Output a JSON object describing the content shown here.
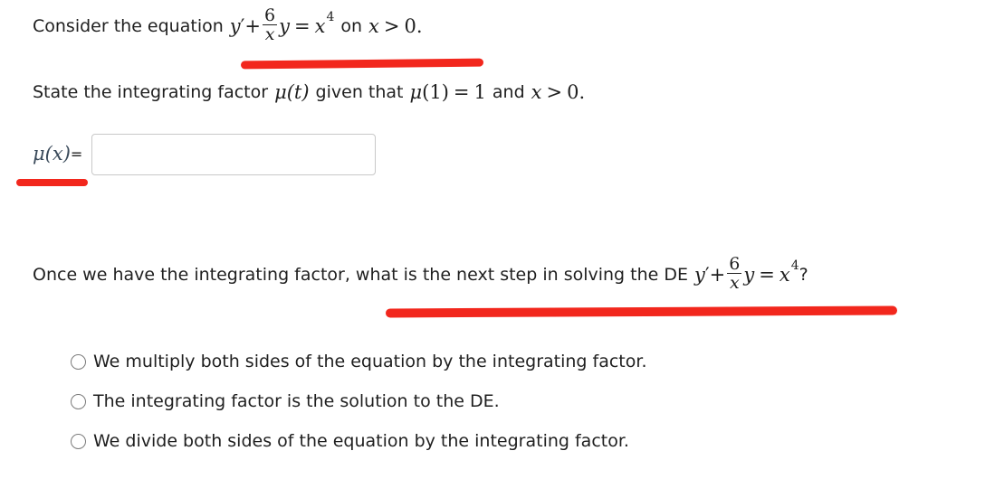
{
  "q1": {
    "prefix": "Consider the equation",
    "y": "y",
    "prime": "′",
    "plus": "+",
    "num": "6",
    "den": "x",
    "y2": "y",
    "eq": "=",
    "x": "x",
    "exp": "4",
    "on": "on",
    "cond_x": "x",
    "cond_gt": ">",
    "cond_zero": "0",
    "cond_dot": "."
  },
  "q2": {
    "prefix": "State the integrating factor",
    "mu": "μ",
    "t": "(t)",
    "given": "given that",
    "mu2": "μ",
    "one_arg": "(1)",
    "eq": "=",
    "one": "1",
    "and": "and",
    "x": "x",
    "gt": ">",
    "zero": "0",
    "dot": "."
  },
  "answer": {
    "mu": "μ",
    "arg": "(x)",
    "eq": "=",
    "value": ""
  },
  "q3": {
    "prefix": "Once we have the integrating factor, what is the next step in solving the DE",
    "y": "y",
    "prime": "′",
    "plus": "+",
    "num": "6",
    "den": "x",
    "y2": "y",
    "eq": "=",
    "x": "x",
    "exp": "4",
    "q": "?"
  },
  "options": [
    {
      "label": "We multiply both sides of the equation by the integrating factor."
    },
    {
      "label": "The integrating factor is the solution to the DE."
    },
    {
      "label": "We divide both sides of the equation by the integrating factor."
    }
  ],
  "colors": {
    "annotation": "#f2271d"
  }
}
